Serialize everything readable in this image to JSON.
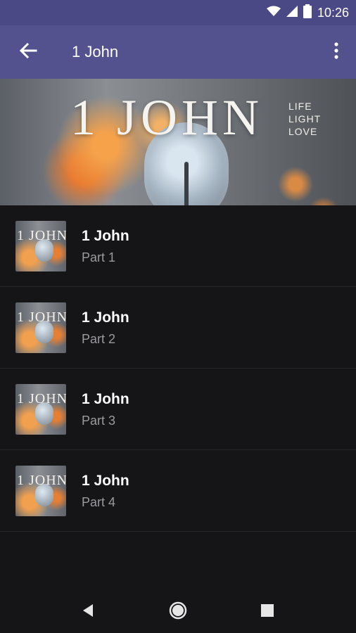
{
  "status_bar": {
    "time": "10:26",
    "icons": [
      "wifi-icon",
      "signal-icon",
      "battery-icon"
    ]
  },
  "app_bar": {
    "title": "1 John",
    "back_icon": "arrow-left-icon",
    "menu_icon": "more-vert-icon"
  },
  "banner": {
    "title": "1 JOHN",
    "words": [
      "LIFE",
      "LIGHT",
      "LOVE"
    ]
  },
  "list": {
    "items": [
      {
        "thumb_text": "1 JOHN",
        "title": "1 John",
        "subtitle": "Part 1"
      },
      {
        "thumb_text": "1 JOHN",
        "title": "1 John",
        "subtitle": "Part 2"
      },
      {
        "thumb_text": "1 JOHN",
        "title": "1 John",
        "subtitle": "Part 3"
      },
      {
        "thumb_text": "1 JOHN",
        "title": "1 John",
        "subtitle": "Part 4"
      }
    ]
  },
  "nav_bar": {
    "icons": [
      "nav-back-icon",
      "nav-home-icon",
      "nav-recent-icon"
    ]
  },
  "colors": {
    "status_bar": "#4b4886",
    "app_bar": "#54518f",
    "background": "#151517",
    "subtitle": "#9a9aa0"
  }
}
